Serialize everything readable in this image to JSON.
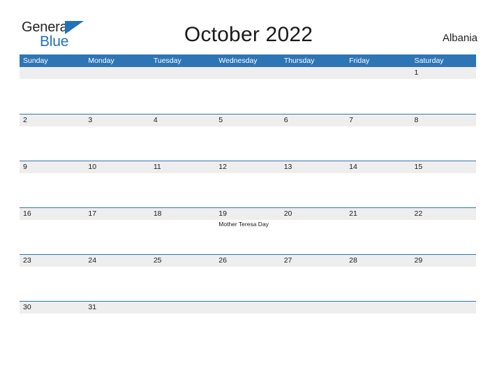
{
  "brand": {
    "name_part1": "General",
    "name_part2": "Blue",
    "triangle_icon": "triangle-icon",
    "color_dark": "#231f20",
    "color_blue": "#2372b9"
  },
  "header": {
    "title": "October 2022",
    "country": "Albania"
  },
  "theme": {
    "header_blue": "#2e75b6",
    "row_band_gray": "#eeeeee",
    "rule_blue": "#2e75b6",
    "text": "#1a1a1a",
    "page_background": "#ffffff"
  },
  "calendar": {
    "month": "October",
    "year": "2022",
    "weekday_headers": [
      "Sunday",
      "Monday",
      "Tuesday",
      "Wednesday",
      "Thursday",
      "Friday",
      "Saturday"
    ],
    "weeks": [
      {
        "days": [
          {
            "number": "",
            "events": []
          },
          {
            "number": "",
            "events": []
          },
          {
            "number": "",
            "events": []
          },
          {
            "number": "",
            "events": []
          },
          {
            "number": "",
            "events": []
          },
          {
            "number": "",
            "events": []
          },
          {
            "number": "1",
            "events": []
          }
        ]
      },
      {
        "days": [
          {
            "number": "2",
            "events": []
          },
          {
            "number": "3",
            "events": []
          },
          {
            "number": "4",
            "events": []
          },
          {
            "number": "5",
            "events": []
          },
          {
            "number": "6",
            "events": []
          },
          {
            "number": "7",
            "events": []
          },
          {
            "number": "8",
            "events": []
          }
        ]
      },
      {
        "days": [
          {
            "number": "9",
            "events": []
          },
          {
            "number": "10",
            "events": []
          },
          {
            "number": "11",
            "events": []
          },
          {
            "number": "12",
            "events": []
          },
          {
            "number": "13",
            "events": []
          },
          {
            "number": "14",
            "events": []
          },
          {
            "number": "15",
            "events": []
          }
        ]
      },
      {
        "days": [
          {
            "number": "16",
            "events": []
          },
          {
            "number": "17",
            "events": []
          },
          {
            "number": "18",
            "events": []
          },
          {
            "number": "19",
            "events": [
              "Mother Teresa Day"
            ]
          },
          {
            "number": "20",
            "events": []
          },
          {
            "number": "21",
            "events": []
          },
          {
            "number": "22",
            "events": []
          }
        ]
      },
      {
        "days": [
          {
            "number": "23",
            "events": []
          },
          {
            "number": "24",
            "events": []
          },
          {
            "number": "25",
            "events": []
          },
          {
            "number": "26",
            "events": []
          },
          {
            "number": "27",
            "events": []
          },
          {
            "number": "28",
            "events": []
          },
          {
            "number": "29",
            "events": []
          }
        ]
      },
      {
        "days": [
          {
            "number": "30",
            "events": []
          },
          {
            "number": "31",
            "events": []
          },
          {
            "number": "",
            "events": []
          },
          {
            "number": "",
            "events": []
          },
          {
            "number": "",
            "events": []
          },
          {
            "number": "",
            "events": []
          },
          {
            "number": "",
            "events": []
          }
        ]
      }
    ]
  }
}
